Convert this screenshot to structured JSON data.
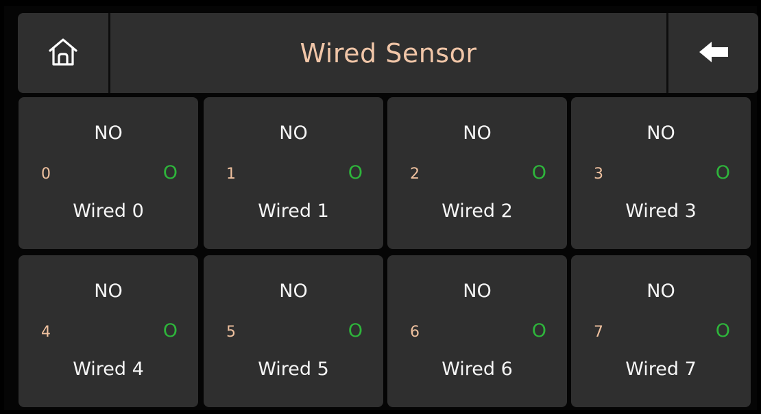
{
  "header": {
    "title": "Wired Sensor",
    "home_icon": "home-icon",
    "back_icon": "arrow-left-icon"
  },
  "colors": {
    "title": "#f1c6a8",
    "number": "#efc19f",
    "status": "#2eb53b",
    "card_bg": "#2f2f2f",
    "background": "#000000"
  },
  "sensors": [
    {
      "state": "NO",
      "number": "0",
      "status": "O",
      "label": "Wired 0"
    },
    {
      "state": "NO",
      "number": "1",
      "status": "O",
      "label": "Wired 1"
    },
    {
      "state": "NO",
      "number": "2",
      "status": "O",
      "label": "Wired 2"
    },
    {
      "state": "NO",
      "number": "3",
      "status": "O",
      "label": "Wired 3"
    },
    {
      "state": "NO",
      "number": "4",
      "status": "O",
      "label": "Wired 4"
    },
    {
      "state": "NO",
      "number": "5",
      "status": "O",
      "label": "Wired 5"
    },
    {
      "state": "NO",
      "number": "6",
      "status": "O",
      "label": "Wired 6"
    },
    {
      "state": "NO",
      "number": "7",
      "status": "O",
      "label": "Wired 7"
    }
  ]
}
